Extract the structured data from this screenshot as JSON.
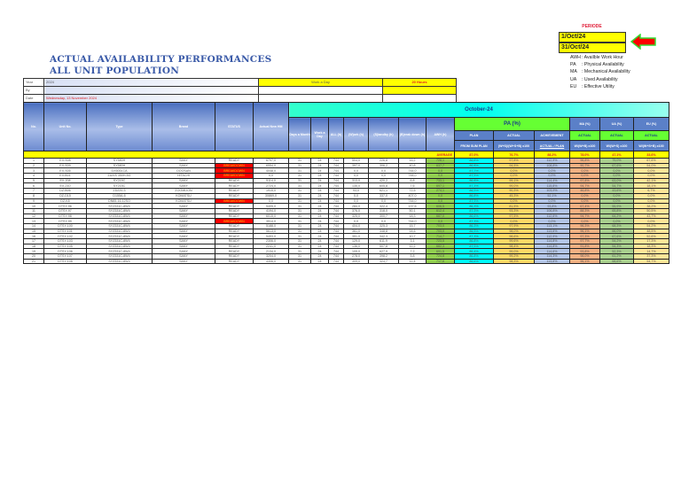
{
  "periode": {
    "label": "PERIODE",
    "start": "1/Oct/24",
    "end": "31/Oct/24"
  },
  "title": {
    "line1": "ACTUAL AVAILABILITY PERFORMANCES",
    "line2": "ALL UNIT POPULATION"
  },
  "legend": [
    {
      "k": "AWH",
      "v": ": Availble Work Hour"
    },
    {
      "k": "PA",
      "v": ": Physical Availability"
    },
    {
      "k": "MA",
      "v": ": Mechanical Availability"
    },
    {
      "k": "UA",
      "v": ": Used Availability"
    },
    {
      "k": "EU",
      "v": ": Effective Utility"
    }
  ],
  "info": {
    "year_label": "Year",
    "year": "2024",
    "by_label": "By",
    "date_label": "Date",
    "date": "Wednesday, 13 November 2024",
    "work_day_label": "Work a Day",
    "work_hours": "20 Hours"
  },
  "headers": {
    "no": "No.",
    "unit": "Unit No.",
    "type": "Type",
    "brand": "Brand",
    "status": "STATUS",
    "hm": "Actual New HM",
    "month": "October-24",
    "days": "Days a Month",
    "workday": "Work a Day",
    "all": "ALL (h)",
    "work": "(W)ork (h)",
    "standby": "(S)tandby (h)",
    "breakdown": "(B)reak down (h)",
    "awh": "AWH (h)",
    "pa": "PA (%)",
    "ma": "MA (%)",
    "ua": "UA (%)",
    "eu": "EU (%)",
    "plan": "PLAN",
    "actual": "ACTUAL",
    "achievement": "ACHIEVEMENT",
    "from_plan": "FROM SUM PLAN",
    "pa_formula": "(W+S)/(W+S+B) x100",
    "ach_formula": "ACTUAL / PLAN",
    "ma_formula": "W/(W+B) x100",
    "ua_formula": "W/(W+S) x100",
    "eu_formula": "W/(W+S+B) x100",
    "average": "AVERAGE"
  },
  "average": {
    "plan": "87,0%",
    "actual": "76,7%",
    "achievement": "88,2%",
    "ma": "78,0%",
    "ua": "47,1%",
    "eu": "33,6%"
  },
  "colors": {
    "breakdown": "#ff0000",
    "average": "#ffff00"
  },
  "rows": [
    [
      "1",
      "EX-S08",
      "SY580H",
      "SANY",
      "READY",
      "6797,0",
      "31",
      "24",
      "744",
      "504,0",
      "226,8",
      "16,2",
      "728,1",
      "86,8%",
      "97,8%",
      "112,9%",
      "96,8%",
      "75,0%",
      "67,6%"
    ],
    [
      "2",
      "EX-S09",
      "SY580H",
      "SANY",
      "BREAKDOWN",
      "6554,0",
      "31",
      "24",
      "744",
      "397,0",
      "306,2",
      "40,8",
      "637,7",
      "86,8%",
      "94,5%",
      "108,8%",
      "90,7%",
      "67,6%",
      "54,0%"
    ],
    [
      "3",
      "EX-S05",
      "DX500LCA",
      "DOOSAN",
      "BREAKDOWN",
      "4048,0",
      "31",
      "24",
      "744",
      "0,0",
      "0,0",
      "744,0",
      "0,0",
      "87,7%",
      "0,0%",
      "0,0%",
      "0,0%",
      "0,0%",
      "0,0%"
    ],
    [
      "4",
      "EX-B01",
      "ZAXIS 350H-5G",
      "HITACHI",
      "BREAKDOWN",
      "0,0",
      "31",
      "24",
      "744",
      "0,0",
      "0,0",
      "744,0",
      "0,0",
      "87,3%",
      "0,0%",
      "0,0%",
      "0,0%",
      "0,0%",
      "0,0%"
    ],
    [
      "5",
      "EX-208",
      "SY215C",
      "SANY",
      "READY",
      "5114,0",
      "31",
      "24",
      "744",
      "313,0",
      "420,2",
      "6,8",
      "733,1",
      "86,8%",
      "99,1%",
      "114,4%",
      "97,8%",
      "63,0%",
      "42,1%"
    ],
    [
      "6",
      "EX-210",
      "SY215C",
      "SANY",
      "READY",
      "2724,0",
      "31",
      "24",
      "744",
      "135,0",
      "605,8",
      "7,6",
      "697,1",
      "87,3%",
      "99,0%",
      "115,8%",
      "94,7%",
      "54,7%",
      "18,1%"
    ],
    [
      "7",
      "DZ-B06",
      "ZD220-3",
      "ZOOMLION",
      "READY",
      "1915,0",
      "31",
      "24",
      "744",
      "93,0",
      "621,1",
      "72,5",
      "274,1",
      "86,3%",
      "90,3%",
      "103,9%",
      "46,8%",
      "43,6%",
      "6,7%"
    ],
    [
      "8",
      "DZ-D15",
      "D155A-6",
      "KOMATSU",
      "READY",
      "30869,0",
      "31",
      "24",
      "744",
      "0,0",
      "337,0",
      "407,0",
      "0,0",
      "86,8%",
      "45,3%",
      "52,1%",
      "0,0%",
      "0,0%",
      "0,0%"
    ],
    [
      "9",
      "DZ-K8",
      "DN65-16-12SO",
      "KOMATSU",
      "BREAKDOWN",
      "0,0",
      "31",
      "24",
      "744",
      "0,0",
      "0,0",
      "744,0",
      "0,0",
      "87,3%",
      "0,0%",
      "0,0%",
      "0,0%",
      "0,0%",
      "0,0%"
    ],
    [
      "10",
      "DTSY-96",
      "SYZ331C-8W4",
      "SANY",
      "READY",
      "5405,0",
      "31",
      "24",
      "744",
      "284,0",
      "322,4",
      "137,6",
      "606,5",
      "86,3%",
      "81,5%",
      "93,8%",
      "67,4%",
      "55,9%",
      "38,2%"
    ],
    [
      "11",
      "DTSY-97",
      "SYZ331C-8W4",
      "SANY",
      "READY",
      "4194,0",
      "31",
      "24",
      "744",
      "376,0",
      "318,0",
      "50,1",
      "612,4",
      "87,3%",
      "93,3%",
      "106,8%",
      "88,3%",
      "65,8%",
      "50,5%"
    ],
    [
      "12",
      "DTSY-98",
      "SYZ331C-8W4",
      "SANY",
      "READY",
      "6015,0",
      "31",
      "24",
      "744",
      "325,0",
      "300,7",
      "18,3",
      "687,0",
      "86,6%",
      "97,5%",
      "112,6%",
      "94,7%",
      "64,2%",
      "43,7%"
    ],
    [
      "13",
      "DTSY-99",
      "SYZ331C-8W4",
      "SANY",
      "BREAKDOWN",
      "3914,0",
      "31",
      "24",
      "744",
      "0,0",
      "0,0",
      "744,0",
      "0,0",
      "87,3%",
      "0,0%",
      "0,0%",
      "0,0%",
      "0,0%",
      "0,0%"
    ],
    [
      "14",
      "DTSY-100",
      "SYZ331C-8W4",
      "SANY",
      "READY",
      "5188,0",
      "31",
      "24",
      "744",
      "404,0",
      "325,3",
      "15,7",
      "703,0",
      "86,3%",
      "97,9%",
      "113,1%",
      "96,3%",
      "68,3%",
      "54,2%"
    ],
    [
      "15",
      "DTSY-101",
      "SYZ331C-8W4",
      "SANY",
      "READY",
      "5613,0",
      "31",
      "24",
      "744",
      "361,0",
      "348,8",
      "14,6",
      "703,0",
      "86,3%",
      "98,0%",
      "113,6%",
      "96,1%",
      "66,0%",
      "48,5%"
    ],
    [
      "16",
      "DTSY-102",
      "SYZ331C-8W4",
      "SANY",
      "READY",
      "5493,0",
      "31",
      "24",
      "744",
      "391,0",
      "342,3",
      "10,7",
      "714,7",
      "87,3%",
      "98,6%",
      "112,9%",
      "97,3%",
      "67,6%",
      "52,6%"
    ],
    [
      "17",
      "DTSY-103",
      "SYZ331C-8W4",
      "SANY",
      "READY",
      "2306,0",
      "31",
      "24",
      "744",
      "129,0",
      "611,9",
      "3,1",
      "723,5",
      "86,8%",
      "99,6%",
      "114,8%",
      "97,7%",
      "54,2%",
      "17,3%"
    ],
    [
      "18",
      "DTSY-105",
      "SYZ331C-8W4",
      "SANY",
      "READY",
      "2241,0",
      "31",
      "24",
      "744",
      "136,0",
      "507,8",
      "12,2",
      "682,3",
      "87,3%",
      "98,4%",
      "114,8%",
      "91,8%",
      "54,3%",
      "18,3%"
    ],
    [
      "19",
      "DTSY-106",
      "SYZ331C-8W4",
      "SANY",
      "READY",
      "2134,0",
      "31",
      "24",
      "744",
      "109,0",
      "627,9",
      "7,2",
      "691,5",
      "86,4%",
      "99,0%",
      "114,6%",
      "93,8%",
      "52,3%",
      "14,7%"
    ],
    [
      "20",
      "DTSY-107",
      "SYZ331C-8W4",
      "SANY",
      "READY",
      "3204,0",
      "31",
      "24",
      "744",
      "278,0",
      "398,2",
      "5,8",
      "724,8",
      "86,8%",
      "99,2%",
      "114,3%",
      "98,0%",
      "61,2%",
      "37,3%"
    ],
    [
      "21",
      "DTSY-108",
      "SYZ331C-8W4",
      "SANY",
      "READY",
      "4306,0",
      "31",
      "24",
      "744",
      "309,0",
      "324,7",
      "12,4",
      "717,6",
      "86,6%",
      "98,3%",
      "113,6%",
      "96,1%",
      "68,6%",
      "54,7%"
    ]
  ]
}
